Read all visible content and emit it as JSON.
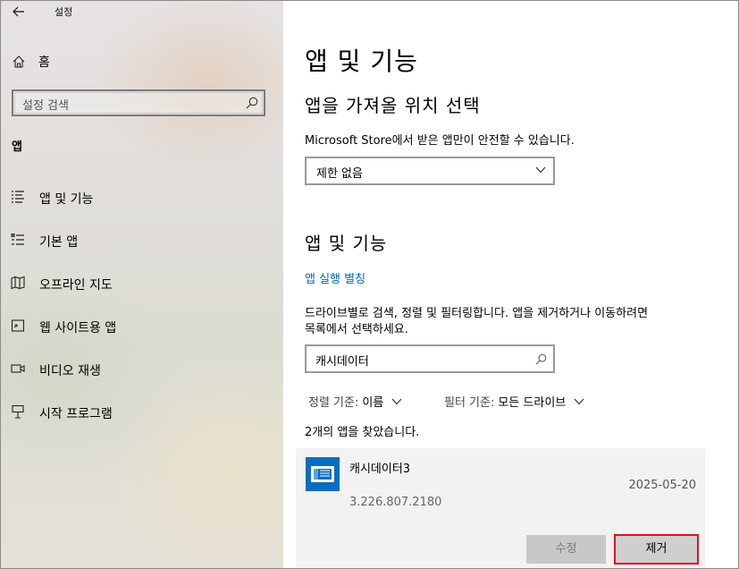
{
  "window": {
    "title": "설정"
  },
  "sidebar": {
    "home_label": "홈",
    "search_placeholder": "설정 검색",
    "section_title": "앱",
    "items": [
      {
        "label": "앱 및 기능",
        "icon": "apps-features-icon"
      },
      {
        "label": "기본 앱",
        "icon": "default-apps-icon"
      },
      {
        "label": "오프라인 지도",
        "icon": "offline-maps-icon"
      },
      {
        "label": "웹 사이트용 앱",
        "icon": "apps-for-websites-icon"
      },
      {
        "label": "비디오 재생",
        "icon": "video-playback-icon"
      },
      {
        "label": "시작 프로그램",
        "icon": "startup-icon"
      }
    ]
  },
  "main": {
    "page_title": "앱 및 기능",
    "install_source": {
      "heading": "앱을 가져올 위치 선택",
      "description": "Microsoft Store에서 받은 앱만이 안전할 수 있습니다.",
      "dropdown_value": "제한 없음"
    },
    "apps_features": {
      "heading": "앱 및 기능",
      "aliases_link": "앱 실행 별칭",
      "description_line1": "드라이브별로 검색, 정렬 및 필터링합니다. 앱을 제거하거나 이동하려면",
      "description_line2": "목록에서 선택하세요.",
      "search_value": "캐시데이터",
      "sort_label": "정렬 기준:",
      "sort_value": "이름",
      "filter_label": "필터 기준:",
      "filter_value": "모든 드라이브",
      "result_count": "2개의 앱을 찾았습니다."
    },
    "app": {
      "name": "캐시데이터3",
      "date": "2025-05-20",
      "version": "3.226.807.2180",
      "modify_label": "수정",
      "remove_label": "제거"
    }
  },
  "colors": {
    "accent": "#0067c0",
    "app_icon": "#0a6dc2",
    "highlight_border": "#e0101c"
  }
}
